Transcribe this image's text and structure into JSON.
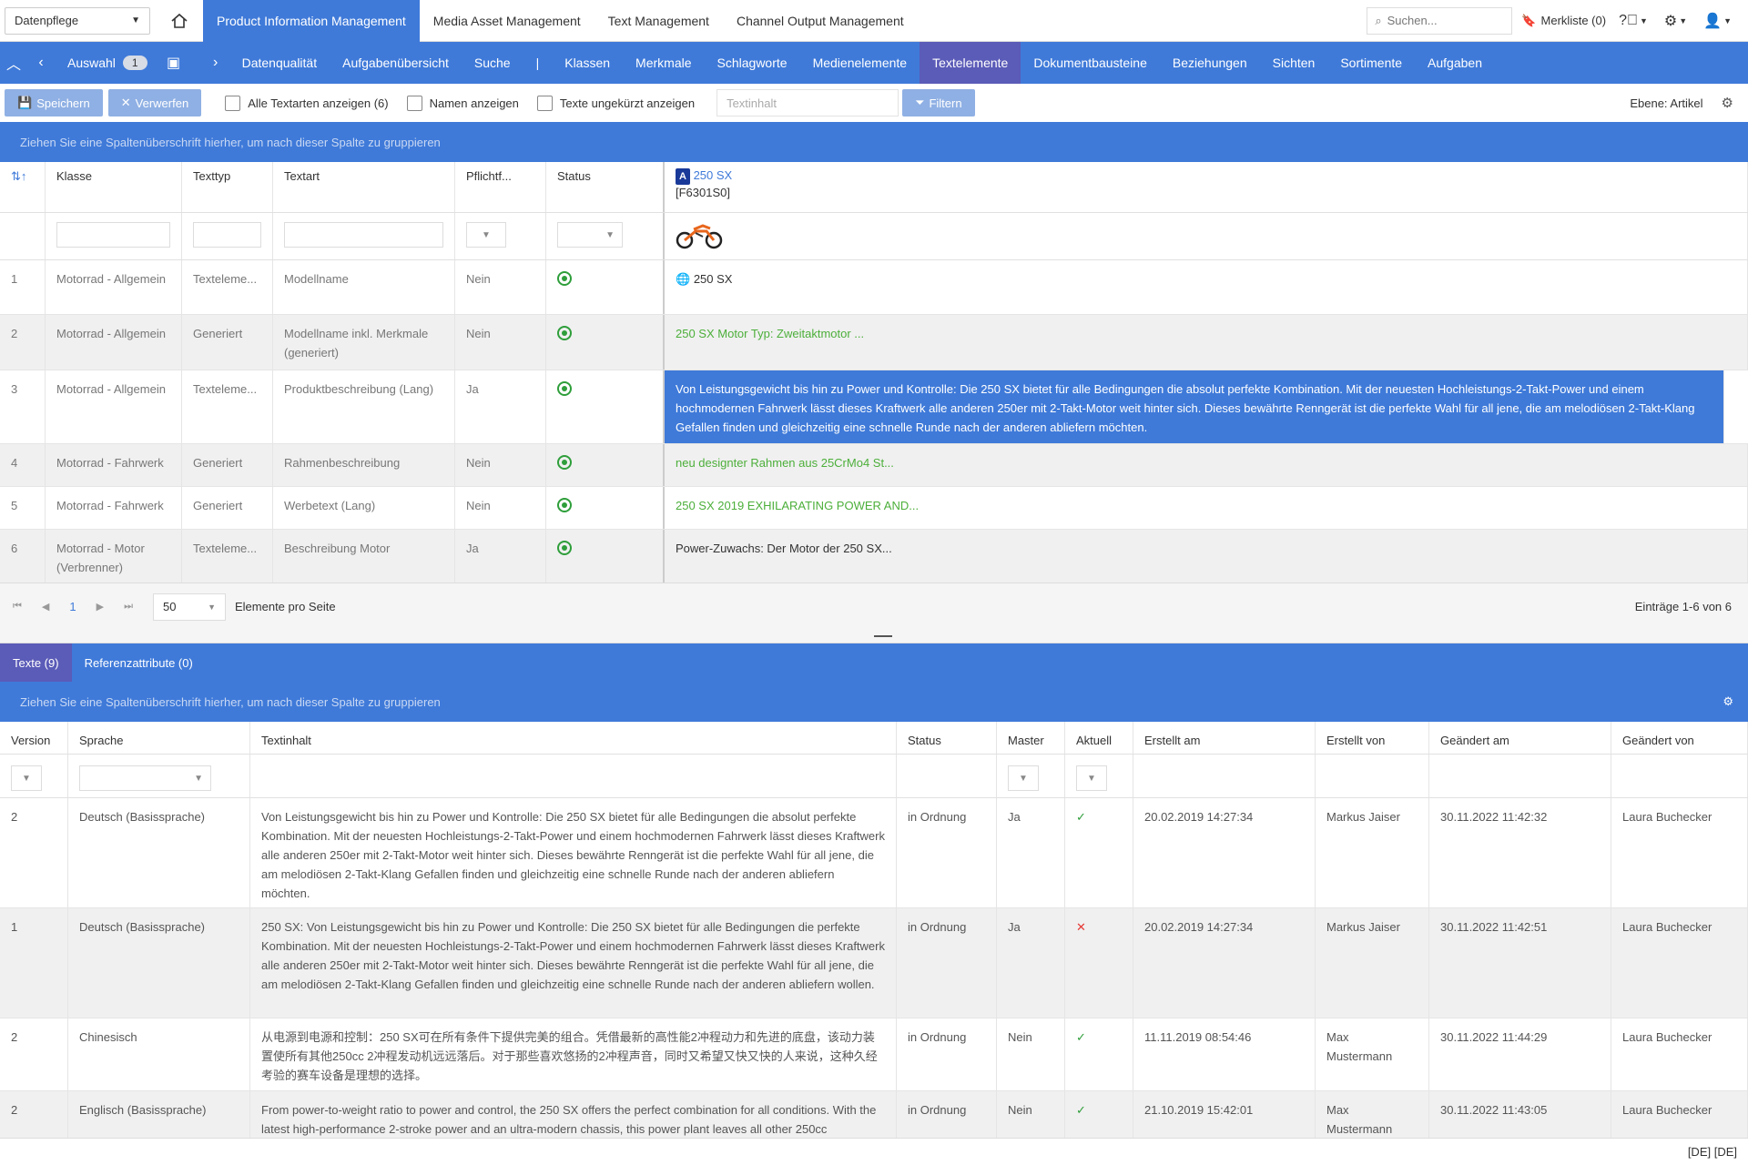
{
  "topbar": {
    "module": "Datenpflege",
    "apps": [
      "Product Information Management",
      "Media Asset Management",
      "Text Management",
      "Channel Output Management"
    ],
    "search_placeholder": "Suchen...",
    "merkliste": "Merkliste (0)"
  },
  "nav": {
    "auswahl": "Auswahl",
    "auswahl_count": "1",
    "items": [
      "Datenqualität",
      "Aufgabenübersicht",
      "Suche",
      "|",
      "Klassen",
      "Merkmale",
      "Schlagworte",
      "Medienelemente",
      "Textelemente",
      "Dokumentbausteine",
      "Beziehungen",
      "Sichten",
      "Sortimente",
      "Aufgaben"
    ]
  },
  "toolbar": {
    "save": "Speichern",
    "discard": "Verwerfen",
    "cb_all": "Alle Textarten anzeigen (6)",
    "cb_names": "Namen anzeigen",
    "cb_full": "Texte ungekürzt anzeigen",
    "text_placeholder": "Textinhalt",
    "filter": "Filtern",
    "ebene": "Ebene: Artikel"
  },
  "group_hint": "Ziehen Sie eine Spaltenüberschrift hierher, um nach dieser Spalte zu gruppieren",
  "grid": {
    "headers": [
      "Klasse",
      "Texttyp",
      "Textart",
      "Pflichtf...",
      "Status"
    ],
    "article_badge": "A",
    "article_name": "250 SX",
    "article_id": "[F6301S0]",
    "rows": [
      {
        "n": "1",
        "klasse": "Motorrad - Allgemein",
        "typ": "Texteleme...",
        "art": "Modellname",
        "pflicht": "Nein",
        "value": "250 SX"
      },
      {
        "n": "2",
        "klasse": "Motorrad - Allgemein",
        "typ": "Generiert",
        "art": "Modellname inkl. Merkmale (generiert)",
        "pflicht": "Nein",
        "value": "250 SX Motor Typ: Zweitaktmotor ..."
      },
      {
        "n": "3",
        "klasse": "Motorrad - Allgemein",
        "typ": "Texteleme...",
        "art": "Produktbeschreibung (Lang)",
        "pflicht": "Ja",
        "value": "Von Leistungsgewicht bis hin zu Power und Kontrolle: Die 250 SX bietet für alle Bedingungen die absolut perfekte Kombination. Mit der neuesten Hochleistungs-2-Takt-Power und einem hochmodernen Fahrwerk lässt dieses Kraftwerk alle anderen 250er mit 2-Takt-Motor weit hinter sich. Dieses bewährte Renngerät ist die perfekte Wahl für all jene, die am melodiösen 2-Takt-Klang Gefallen finden und gleichzeitig eine schnelle Runde nach der anderen abliefern möchten."
      },
      {
        "n": "4",
        "klasse": "Motorrad - Fahrwerk",
        "typ": "Generiert",
        "art": "Rahmenbeschreibung",
        "pflicht": "Nein",
        "value": "neu designter Rahmen aus 25CrMo4 St..."
      },
      {
        "n": "5",
        "klasse": "Motorrad - Fahrwerk",
        "typ": "Generiert",
        "art": "Werbetext (Lang)",
        "pflicht": "Nein",
        "value": "250 SX 2019 EXHILARATING POWER AND..."
      },
      {
        "n": "6",
        "klasse": "Motorrad - Motor (Verbrenner)",
        "typ": "Texteleme...",
        "art": "Beschreibung Motor",
        "pflicht": "Ja",
        "value": "Power-Zuwachs: Der Motor der 250 SX..."
      }
    ]
  },
  "pager": {
    "page": "1",
    "size": "50",
    "label": "Elemente pro Seite",
    "entries": "Einträge 1-6 von 6"
  },
  "bottom": {
    "tabs": [
      "Texte (9)",
      "Referenzattribute (0)"
    ],
    "headers": [
      "Version",
      "Sprache",
      "Textinhalt",
      "Status",
      "Master",
      "Aktuell",
      "Erstellt am",
      "Erstellt von",
      "Geändert am",
      "Geändert von"
    ],
    "rows": [
      {
        "v": "2",
        "lang": "Deutsch (Basissprache)",
        "text": "Von Leistungsgewicht bis hin zu Power und Kontrolle: Die 250 SX bietet für alle Bedingungen die absolut perfekte Kombination. Mit der neuesten Hochleistungs-2-Takt-Power und einem hochmodernen Fahrwerk lässt dieses Kraftwerk alle anderen 250er mit 2-Takt-Motor weit hinter sich. Dieses bewährte Renngerät ist die perfekte Wahl für all jene, die am melodiösen 2-Takt-Klang Gefallen finden und gleichzeitig eine schnelle Runde nach der anderen abliefern möchten.",
        "status": "in Ordnung",
        "master": "Ja",
        "aktuell": "✓",
        "created": "20.02.2019 14:27:34",
        "by": "Markus Jaiser",
        "changed": "30.11.2022 11:42:32",
        "cby": "Laura Buchecker"
      },
      {
        "v": "1",
        "lang": "Deutsch (Basissprache)",
        "text": "250 SX: Von Leistungsgewicht bis hin zu Power und Kontrolle: Die 250 SX bietet für alle Bedingungen die perfekte Kombination. Mit der neuesten Hochleistungs-2-Takt-Power und einem hochmodernen Fahrwerk lässt dieses Kraftwerk alle anderen 250er mit 2-Takt-Motor weit hinter sich. Dieses bewährte Renngerät ist die perfekte Wahl für all jene, die am melodiösen 2-Takt-Klang Gefallen finden und gleichzeitig eine schnelle Runde nach der anderen abliefern wollen.",
        "status": "in Ordnung",
        "master": "Ja",
        "aktuell": "✕",
        "created": "20.02.2019 14:27:34",
        "by": "Markus Jaiser",
        "changed": "30.11.2022 11:42:51",
        "cby": "Laura Buchecker"
      },
      {
        "v": "2",
        "lang": "Chinesisch",
        "text": "从电源到电源和控制：250 SX可在所有条件下提供完美的组合。凭借最新的高性能2冲程动力和先进的底盘，该动力装置使所有其他250cc 2冲程发动机远远落后。对于那些喜欢悠扬的2冲程声音，同时又希望又快又快的人来说，这种久经考验的赛车设备是理想的选择。",
        "status": "in Ordnung",
        "master": "Nein",
        "aktuell": "✓",
        "created": "11.11.2019 08:54:46",
        "by": "Max Mustermann",
        "changed": "30.11.2022 11:44:29",
        "cby": "Laura Buchecker"
      },
      {
        "v": "2",
        "lang": "Englisch (Basissprache)",
        "text": "From power-to-weight ratio to power and control, the 250 SX offers the perfect combination for all conditions. With the latest high-performance 2-stroke power and an ultra-modern chassis, this power plant leaves all other 250cc",
        "status": "in Ordnung",
        "master": "Nein",
        "aktuell": "✓",
        "created": "21.10.2019 15:42:01",
        "by": "Max Mustermann",
        "changed": "30.11.2022 11:43:05",
        "cby": "Laura Buchecker"
      }
    ]
  },
  "footer": "[DE] [DE]"
}
